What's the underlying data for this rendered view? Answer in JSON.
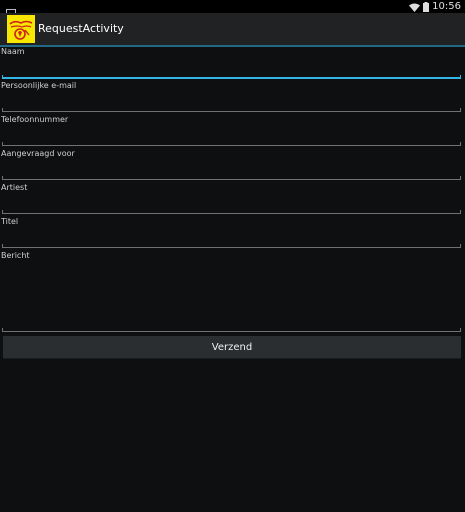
{
  "status_bar": {
    "time": "10:56",
    "icons": [
      "gallery-icon",
      "wifi-icon",
      "battery-icon"
    ]
  },
  "action_bar": {
    "title": "RequestActivity",
    "logo_icon": "app-logo-icon"
  },
  "form": {
    "fields": [
      {
        "label": "Naam",
        "value": ""
      },
      {
        "label": "Persoonlijke e-mail",
        "value": ""
      },
      {
        "label": "Telefoonnummer",
        "value": ""
      },
      {
        "label": "Aangevraagd voor",
        "value": ""
      },
      {
        "label": "Artiest",
        "value": ""
      },
      {
        "label": "Titel",
        "value": ""
      },
      {
        "label": "Bericht",
        "value": ""
      }
    ],
    "submit_label": "Verzend"
  },
  "colors": {
    "background": "#0e0f10",
    "action_bar": "#202224",
    "accent": "#33b5e5",
    "button": "#2b2e31"
  }
}
